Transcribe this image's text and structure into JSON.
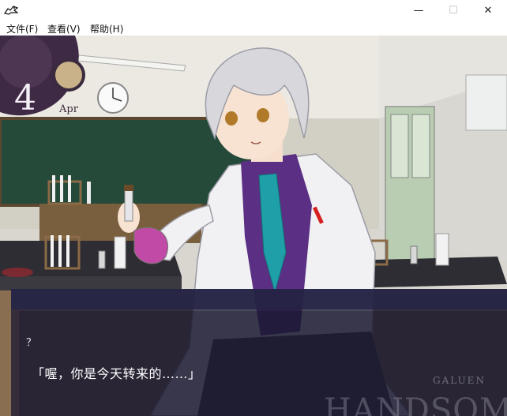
{
  "window": {
    "icon": "crocodile-app-icon",
    "controls": {
      "minimize": "—",
      "maximize": "☐",
      "close": "✕"
    }
  },
  "menu": {
    "file": "文件(F)",
    "view": "查看(V)",
    "help": "帮助(H)"
  },
  "calendar": {
    "day": "4",
    "month": "Apr"
  },
  "dialogue": {
    "speaker": "？",
    "text": "「喔，你是今天转来的……」"
  },
  "watermark": {
    "small": "GALUEN",
    "big": "HANDSOME"
  },
  "colors": {
    "dialogue_box": "#1e1c33",
    "name_bar": "#262448",
    "calendar_ring": "#3e2a45",
    "tie": "#1fa0a8",
    "shirt": "#5a2f84",
    "hair": "#d8d8dc",
    "chalkboard": "#254a3a"
  }
}
